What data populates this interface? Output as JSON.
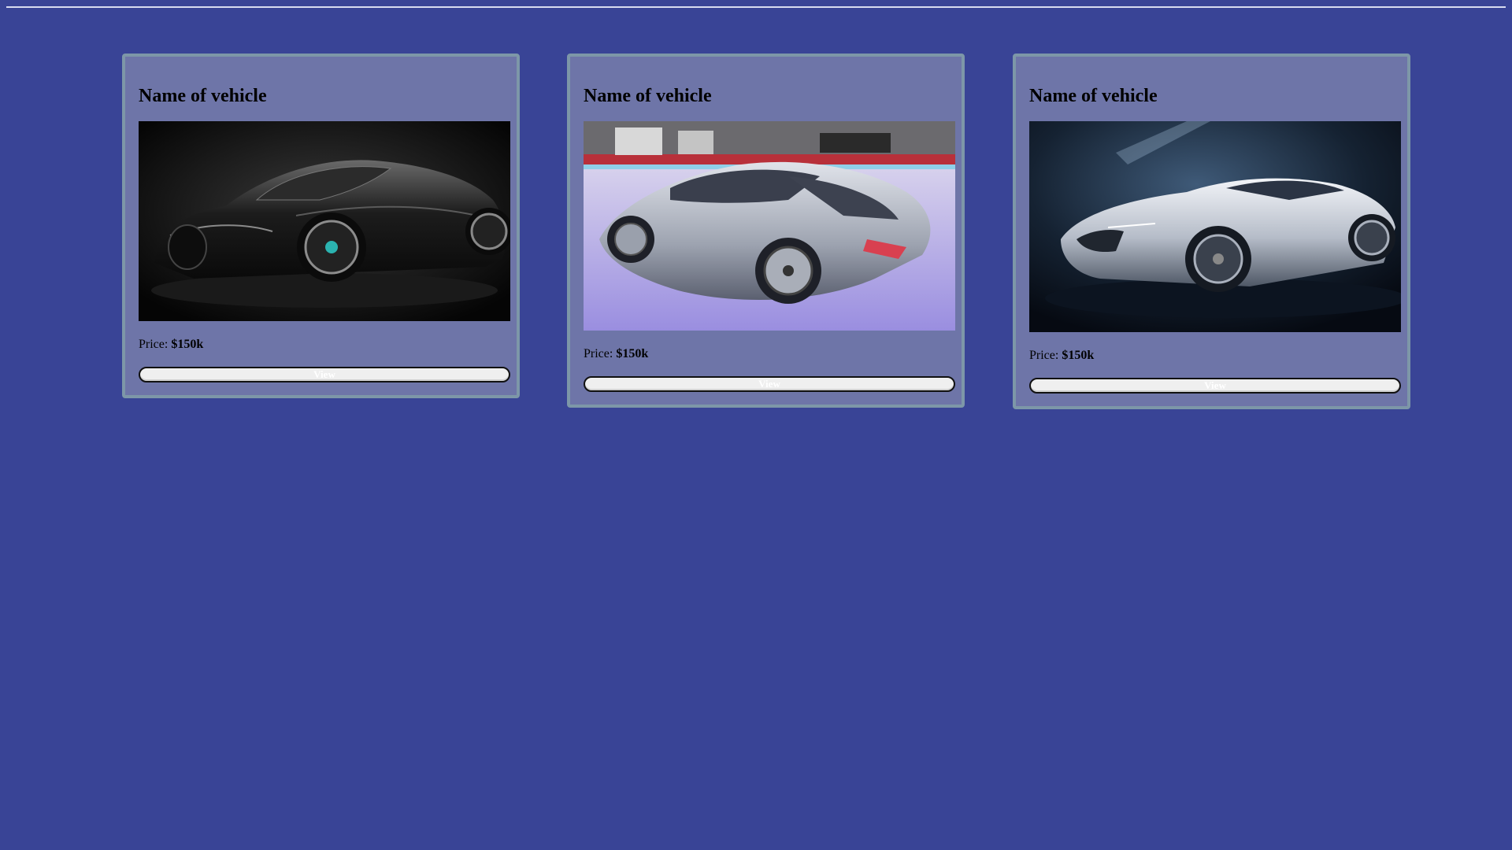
{
  "colors": {
    "page_background": "#394496",
    "card_background": "#6e75a8",
    "card_border": "#7d97a8",
    "button_background": "#efefef",
    "button_text": "#ffffff"
  },
  "vehicles": [
    {
      "title": "Name of vehicle",
      "price_label": "Price: ",
      "price_value": "$150k",
      "button_label": "View",
      "image": "black-hypercar-photo"
    },
    {
      "title": "Name of vehicle",
      "price_label": "Price: ",
      "price_value": "$150k",
      "button_label": "View",
      "image": "silver-supercar-showroom-photo"
    },
    {
      "title": "Name of vehicle",
      "price_label": "Price: ",
      "price_value": "$150k",
      "button_label": "View",
      "image": "silver-concept-car-photo"
    }
  ]
}
